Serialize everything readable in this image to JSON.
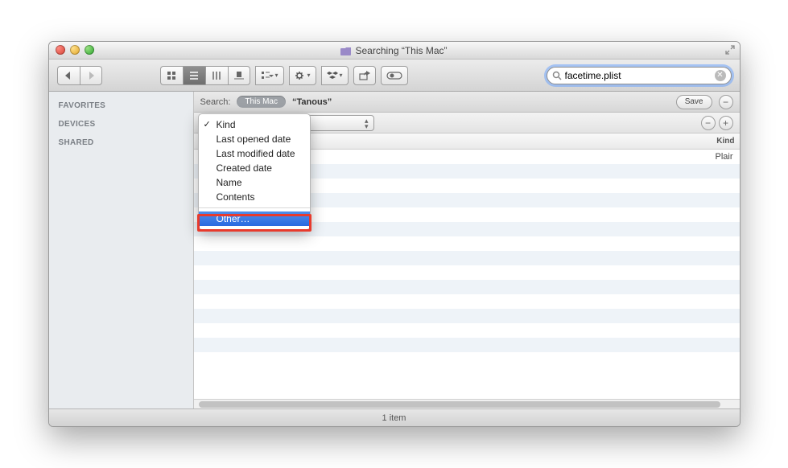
{
  "window": {
    "title": "Searching “This Mac”"
  },
  "sidebar": {
    "items": [
      {
        "label": "FAVORITES"
      },
      {
        "label": "DEVICES"
      },
      {
        "label": "SHARED"
      }
    ]
  },
  "search": {
    "placeholder": "Search",
    "value": "facetime.plist"
  },
  "searchbar": {
    "label": "Search:",
    "scopes": [
      {
        "label": "This Mac",
        "selected": true
      },
      {
        "label": "“Tanous”",
        "selected": false
      }
    ],
    "save": "Save"
  },
  "criteria": {
    "value_field": "",
    "dropdown": {
      "items": [
        {
          "label": "Kind",
          "checked": true
        },
        {
          "label": "Last opened date"
        },
        {
          "label": "Last modified date"
        },
        {
          "label": "Created date"
        },
        {
          "label": "Name"
        },
        {
          "label": "Contents"
        }
      ],
      "other": "Other…"
    }
  },
  "columns": {
    "kind": "Kind"
  },
  "results": {
    "first_kind": "Plair"
  },
  "status": {
    "text": "1 item"
  },
  "icons": {
    "minus": "−",
    "plus": "+",
    "caret_up": "▴",
    "caret_down": "▾",
    "check": "✓",
    "clear": "✕"
  }
}
